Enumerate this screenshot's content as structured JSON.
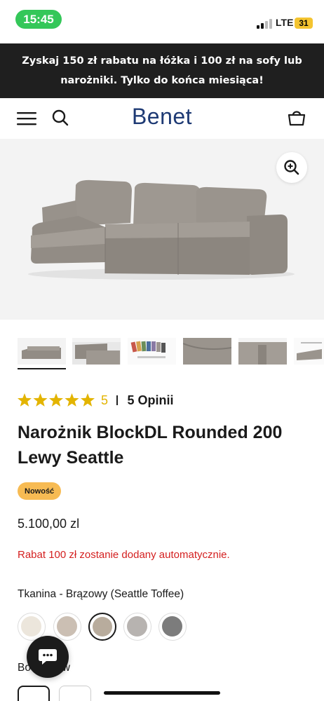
{
  "status_bar": {
    "time": "15:45",
    "network": "LTE",
    "battery": "31"
  },
  "promo": {
    "text": "Zyskaj 150 zł rabatu na łóżka i 100 zł na sofy lub narożniki. Tylko do końca miesiąca!"
  },
  "header": {
    "logo": "Benet",
    "icons": [
      "menu-icon",
      "search-icon",
      "cart-icon"
    ]
  },
  "gallery": {
    "thumbnail_count": 6,
    "active_index": 0
  },
  "rating": {
    "stars": 5,
    "score": "5",
    "reviews": "5 Opinii"
  },
  "product": {
    "title": "Narożnik BlockDL Rounded 200 Lewy Seattle",
    "badge": "Nowość",
    "price": "5.100,00 zl",
    "discount_note": "Rabat 100 zł zostanie dodany automatycznie."
  },
  "options": {
    "fabric_label": "Tkanina - Brązowy (Seattle Toffee)",
    "fabric_swatches": [
      {
        "color": "#ece6dc"
      },
      {
        "color": "#cbbfb3"
      },
      {
        "color": "#b8ac9d",
        "selected": true
      },
      {
        "color": "#b7b3b0"
      },
      {
        "color": "#7c7c7c"
      }
    ],
    "side_label_visible": "Bo      rrow"
  },
  "colors": {
    "accent": "#1e3a74",
    "promo_bg": "#1f1f1f",
    "star": "#e3b400",
    "badge": "#f7bb53",
    "discount": "#d42020"
  }
}
